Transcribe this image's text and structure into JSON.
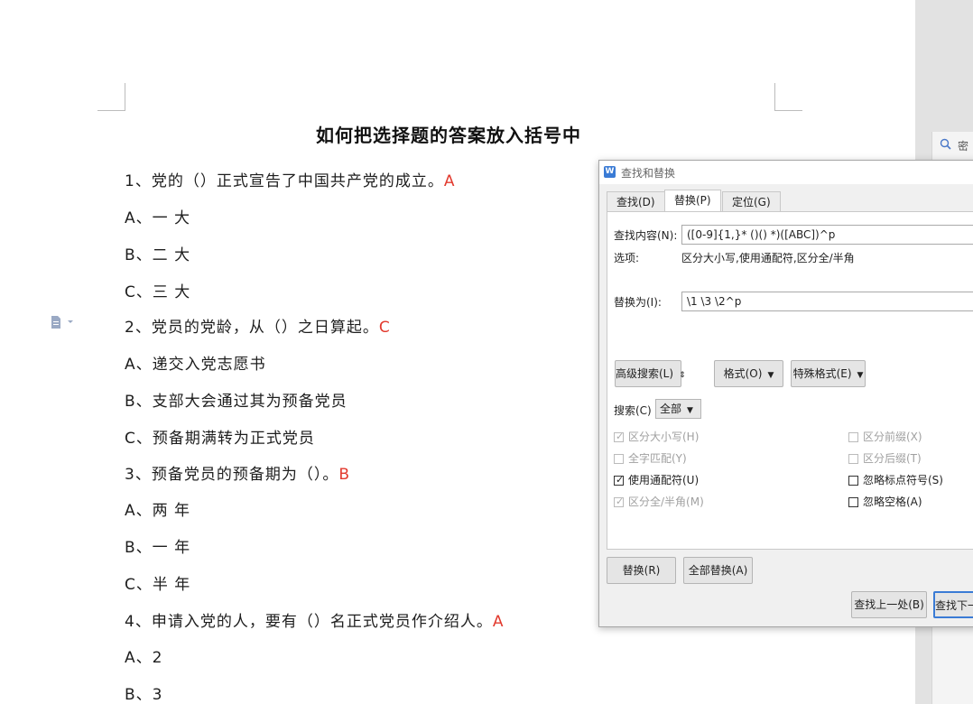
{
  "document": {
    "title": "如何把选择题的答案放入括号中",
    "lines": [
      {
        "text": "1、党的（）正式宣告了中国共产党的成立。",
        "answer": "A"
      },
      {
        "text": "A、一  大",
        "answer": ""
      },
      {
        "text": "B、二  大",
        "answer": ""
      },
      {
        "text": "C、三  大",
        "answer": ""
      },
      {
        "text": "2、党员的党龄，从（）之日算起。",
        "answer": "C"
      },
      {
        "text": "A、递交入党志愿书",
        "answer": ""
      },
      {
        "text": "B、支部大会通过其为预备党员",
        "answer": ""
      },
      {
        "text": "C、预备期满转为正式党员",
        "answer": ""
      },
      {
        "text": "3、预备党员的预备期为（）。",
        "answer": "B"
      },
      {
        "text": "A、两  年",
        "answer": ""
      },
      {
        "text": "B、一  年",
        "answer": ""
      },
      {
        "text": "C、半  年",
        "answer": ""
      },
      {
        "text": "4、申请入党的人，要有（）名正式党员作介绍人。",
        "answer": "A"
      },
      {
        "text": "A、2",
        "answer": ""
      },
      {
        "text": "B、3",
        "answer": ""
      }
    ]
  },
  "side_panel": {
    "text": "密"
  },
  "dialog": {
    "title": "查找和替换",
    "tabs": [
      "查找(D)",
      "替换(P)",
      "定位(G)"
    ],
    "find_label": "查找内容(N):",
    "find_value": "([0-9]{1,}*  ()()  *)([ABC])^p",
    "options_label": "选项:",
    "options_value": "区分大小写,使用通配符,区分全/半角",
    "replace_label": "替换为(I):",
    "replace_value": "\\1 \\3 \\2^p",
    "buttons": {
      "advanced": "高级搜索(L)",
      "format": "格式(O)",
      "special": "特殊格式(E)",
      "replace": "替换(R)",
      "replace_all": "全部替换(A)",
      "find_prev": "查找上一处(B)",
      "find_next": "查找下一"
    },
    "search_label": "搜索(C)",
    "search_value": "全部",
    "checkboxes_left": [
      {
        "label": "区分大小写(H)",
        "checked": true,
        "disabled": true
      },
      {
        "label": "全字匹配(Y)",
        "checked": false,
        "disabled": true
      },
      {
        "label": "使用通配符(U)",
        "checked": true,
        "disabled": false
      },
      {
        "label": "区分全/半角(M)",
        "checked": true,
        "disabled": true
      }
    ],
    "checkboxes_right": [
      {
        "label": "区分前缀(X)",
        "checked": false,
        "disabled": true
      },
      {
        "label": "区分后缀(T)",
        "checked": false,
        "disabled": true
      },
      {
        "label": "忽略标点符号(S)",
        "checked": false,
        "disabled": false
      },
      {
        "label": "忽略空格(A)",
        "checked": false,
        "disabled": false
      }
    ]
  }
}
